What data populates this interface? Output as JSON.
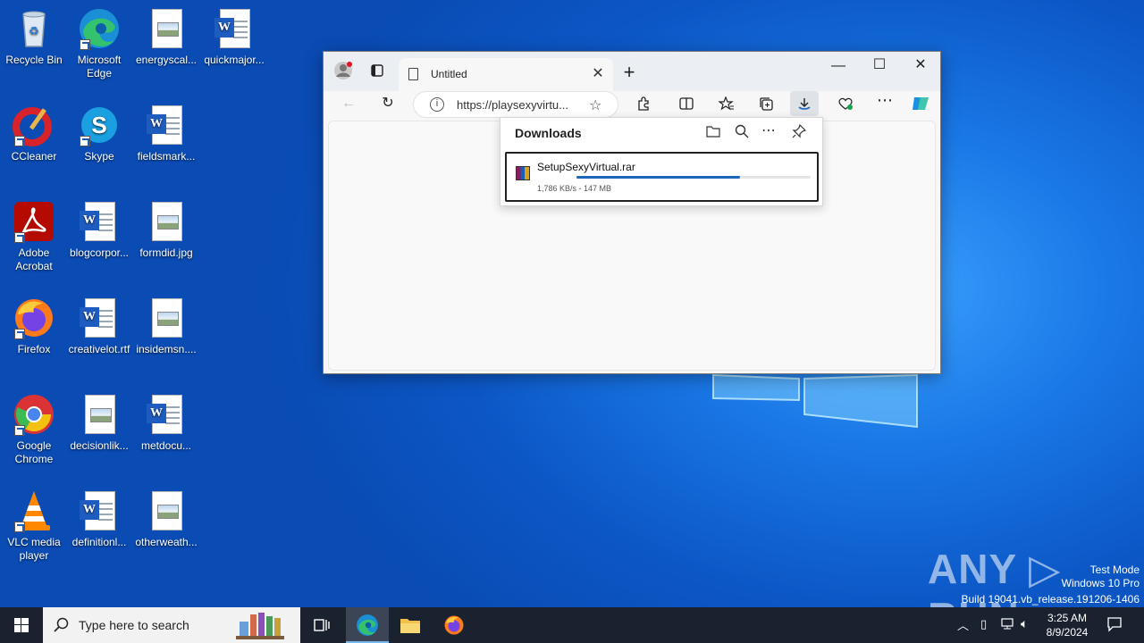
{
  "desktop": {
    "icons": [
      {
        "label": "Recycle Bin"
      },
      {
        "label": "Microsoft Edge"
      },
      {
        "label": "energyscal..."
      },
      {
        "label": "quickmajor..."
      },
      {
        "label": "CCleaner"
      },
      {
        "label": "Skype"
      },
      {
        "label": "fieldsmark..."
      },
      {
        "label": "Adobe Acrobat"
      },
      {
        "label": "blogcorpor..."
      },
      {
        "label": "formdid.jpg"
      },
      {
        "label": "Firefox"
      },
      {
        "label": "creativelot.rtf"
      },
      {
        "label": "insidemsn...."
      },
      {
        "label": "Google Chrome"
      },
      {
        "label": "decisionlik..."
      },
      {
        "label": "metdocu..."
      },
      {
        "label": "VLC media player"
      },
      {
        "label": "definitionl..."
      },
      {
        "label": "otherweath..."
      }
    ]
  },
  "browser": {
    "tab_title": "Untitled",
    "url": "https://playsexyvirtu...",
    "downloads": {
      "title": "Downloads",
      "item_name": "SetupSexyVirtual.rar",
      "status": "1,786 KB/s - 147 MB",
      "progress": 0.7
    }
  },
  "taskbar": {
    "search_placeholder": "Type here to search",
    "time": "3:25 AM",
    "date": "8/9/2024"
  },
  "watermark": {
    "line1": "Test Mode",
    "line2": "Windows 10 Pro",
    "line3": "Build 19041.vb_release.191206-1406",
    "brand": "ANY RUN"
  },
  "colors": {
    "accent": "#1b66b8",
    "taskbar": "#1a2230"
  }
}
